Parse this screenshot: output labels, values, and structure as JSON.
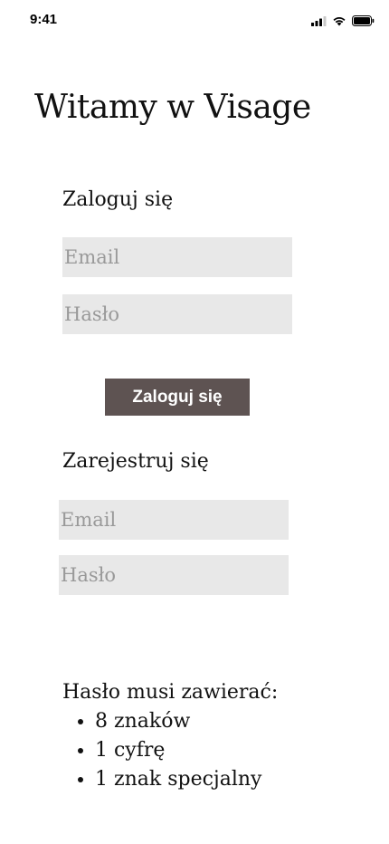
{
  "status_bar": {
    "time": "9:41",
    "icons": [
      "cellular-signal-icon",
      "wifi-icon",
      "battery-icon"
    ]
  },
  "title": "Witamy w Visage",
  "login": {
    "heading": "Zaloguj się",
    "email_placeholder": "Email",
    "password_placeholder": "Hasło",
    "button_label": "Zaloguj się"
  },
  "register": {
    "heading": "Zarejestruj się",
    "email_placeholder": "Email",
    "password_placeholder": "Hasło"
  },
  "requirements": {
    "title": "Hasło musi zawierać:",
    "items": [
      "8 znaków",
      "1 cyfrę",
      "1 znak specjalny"
    ]
  },
  "colors": {
    "button_background": "#5e5352",
    "field_background": "#e8e8e8",
    "placeholder": "#999999"
  }
}
